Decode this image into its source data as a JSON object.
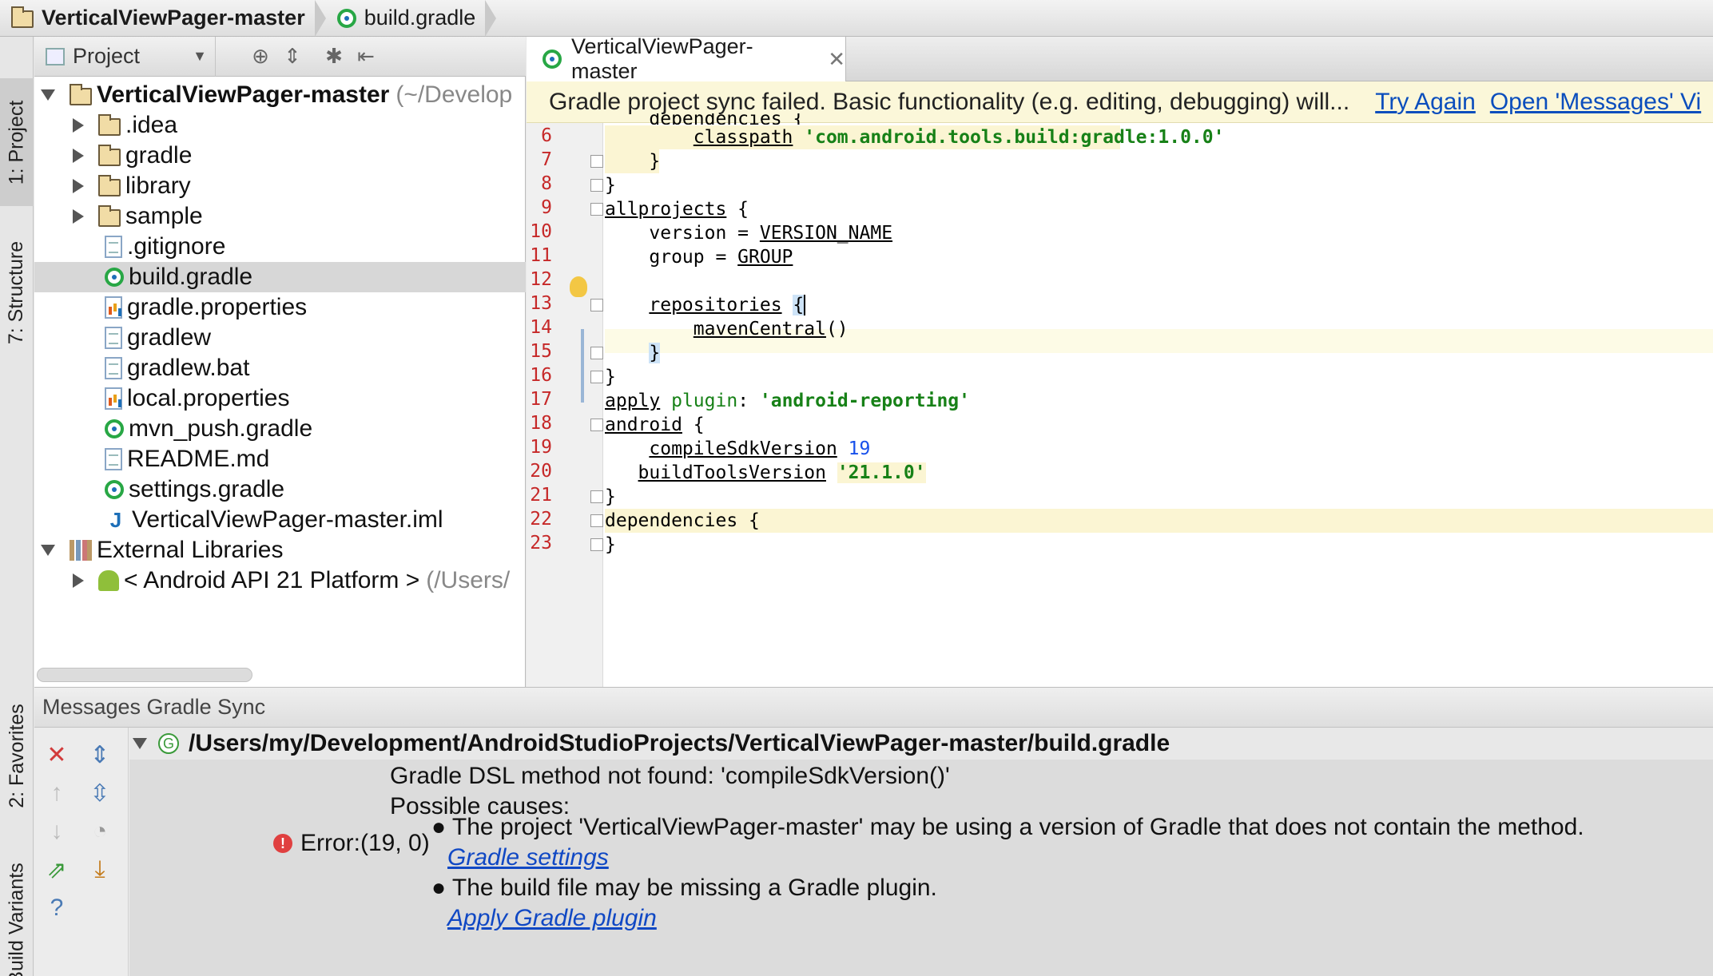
{
  "breadcrumb": {
    "project": "VerticalViewPager-master",
    "file": "build.gradle"
  },
  "left_strip": {
    "project_tab": "1: Project",
    "structure_tab": "7: Structure",
    "favorites_tab": "2: Favorites",
    "build_variants_tab": "Build Variants"
  },
  "project_panel": {
    "view_selector": "Project",
    "tree": [
      {
        "label": "VerticalViewPager-master",
        "suffix": "(~/Develop",
        "icon": "module-folder-icon"
      },
      {
        "label": ".idea",
        "icon": "folder-icon"
      },
      {
        "label": "gradle",
        "icon": "folder-icon"
      },
      {
        "label": "library",
        "icon": "folder-icon"
      },
      {
        "label": "sample",
        "icon": "folder-icon"
      },
      {
        "label": ".gitignore",
        "icon": "text-file-icon"
      },
      {
        "label": "build.gradle",
        "icon": "gradle-file-icon"
      },
      {
        "label": "gradle.properties",
        "icon": "properties-file-icon"
      },
      {
        "label": "gradlew",
        "icon": "text-file-icon"
      },
      {
        "label": "gradlew.bat",
        "icon": "text-file-icon"
      },
      {
        "label": "local.properties",
        "icon": "properties-file-icon"
      },
      {
        "label": "mvn_push.gradle",
        "icon": "gradle-file-icon"
      },
      {
        "label": "README.md",
        "icon": "text-file-icon"
      },
      {
        "label": "settings.gradle",
        "icon": "gradle-file-icon"
      },
      {
        "label": "VerticalViewPager-master.iml",
        "icon": "iml-file-icon"
      },
      {
        "label": "External Libraries",
        "icon": "libraries-icon"
      },
      {
        "label": "< Android API 21 Platform >",
        "suffix": "(/Users/",
        "icon": "android-icon"
      }
    ]
  },
  "editor": {
    "tab_label": "VerticalViewPager-master",
    "banner": {
      "message": "Gradle project sync failed. Basic functionality (e.g. editing, debugging) will...",
      "try_again": "Try Again",
      "open_messages": "Open 'Messages' Vi"
    },
    "line_numbers": [
      "6",
      "7",
      "8",
      "9",
      "10",
      "11",
      "12",
      "13",
      "14",
      "15",
      "16",
      "17",
      "18",
      "19",
      "20",
      "21",
      "22",
      "23"
    ],
    "code": {
      "l5": "    dependencies {",
      "l6a": "        ",
      "l6b": "classpath",
      "l6c": " ",
      "l6d": "'com.android.tools.build:gradle:1.0.0'",
      "l7": "    }",
      "l8": "}",
      "l9a": "allprojects",
      "l9b": " {",
      "l10a": "    version = ",
      "l10b": "VERSION_NAME",
      "l11a": "    group = ",
      "l11b": "GROUP",
      "l13a": "    ",
      "l13b": "repositories",
      "l13c": " ",
      "l13d": "{",
      "l14a": "        ",
      "l14b": "mavenCentral",
      "l14c": "()",
      "l15a": "    ",
      "l15b": "}",
      "l16": "}",
      "l17a": "apply",
      "l17b": " plugin",
      "l17c": ": ",
      "l17d": "'android-reporting'",
      "l18a": "android",
      "l18b": " {",
      "l19a": "    ",
      "l19b": "compileSdkVersion",
      "l19c": " ",
      "l19d": "19",
      "l20a": "   ",
      "l20b": "buildToolsVersion",
      "l20c": " ",
      "l20d": "'21.1.0'",
      "l21": "}",
      "l22a": "dependencies",
      "l22b": " {",
      "l23": "}"
    }
  },
  "messages": {
    "header": "Messages Gradle Sync",
    "file_path": "/Users/my/Development/AndroidStudioProjects/VerticalViewPager-master/build.gradle",
    "error_title": "Gradle DSL method not found: 'compileSdkVersion()'",
    "possible_causes": "Possible causes:",
    "error_location": "Error:(19, 0)",
    "cause1": "The project 'VerticalViewPager-master' may be using a version of Gradle that does not contain the method.",
    "cause1_link": "Gradle settings",
    "cause2": "The build file may be missing a Gradle plugin.",
    "cause2_link": "Apply Gradle plugin"
  },
  "colors": {
    "banner_bg": "#fbf7d9",
    "link": "#0b4ebd",
    "string_green": "#178117",
    "line_number_red": "#c62828",
    "error_red": "#e04040"
  }
}
